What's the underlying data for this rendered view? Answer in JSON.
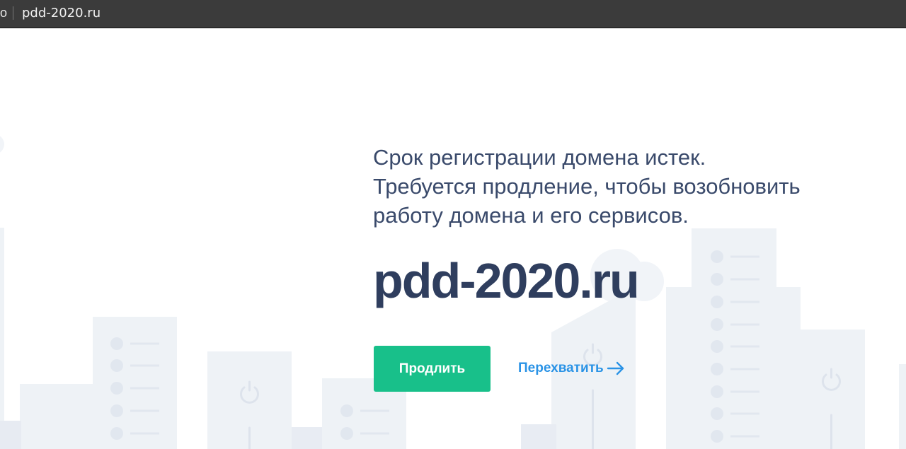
{
  "browser": {
    "tab_fragment": "o",
    "url": "pdd-2020.ru"
  },
  "page": {
    "notice_lines": [
      "Срок регистрации домена истек.",
      "Требуется продление, чтобы возобновить",
      "работу домена и его сервисов."
    ],
    "domain": "pdd-2020.ru",
    "renew_label": "Продлить",
    "intercept_label": "Перехватить"
  },
  "colors": {
    "accent_green": "#18c08a",
    "link_blue": "#2a93e6",
    "text_dark": "#2f3e5e",
    "illustration": "#eef2f6"
  },
  "icons": {
    "intercept_arrow": "arrow-right-icon",
    "building_power": "power-icon"
  }
}
